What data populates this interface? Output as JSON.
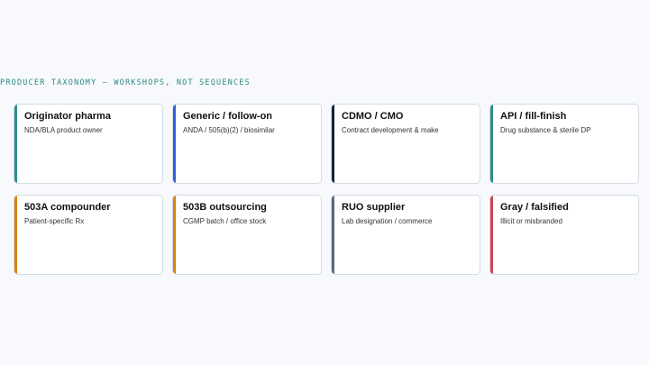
{
  "header": {
    "title": "PRODUCER TAXONOMY — WORKSHOPS, NOT SEQUENCES"
  },
  "cards": [
    {
      "key": "originator-pharma",
      "title": "Originator pharma",
      "subtitle": "NDA/BLA product owner",
      "accent_color": "#2e8b8b"
    },
    {
      "key": "generic-follow-on",
      "title": "Generic / follow-on",
      "subtitle": "ANDA / 505(b)(2) / biosimilar",
      "accent_color": "#3461d9"
    },
    {
      "key": "cdmo-cmo",
      "title": "CDMO / CMO",
      "subtitle": "Contract development & make",
      "accent_color": "#132339"
    },
    {
      "key": "api-fill-finish",
      "title": "API / fill-finish",
      "subtitle": "Drug substance & sterile DP",
      "accent_color": "#2e8b8b"
    },
    {
      "key": "503a-compounder",
      "title": "503A compounder",
      "subtitle": "Patient-specific Rx",
      "accent_color": "#d98016"
    },
    {
      "key": "503b-outsourcing",
      "title": "503B outsourcing",
      "subtitle": "CGMP batch / office stock",
      "accent_color": "#d98016"
    },
    {
      "key": "ruo-supplier",
      "title": "RUO supplier",
      "subtitle": "Lab designation / commerce",
      "accent_color": "#5a6781"
    },
    {
      "key": "gray-falsified",
      "title": "Gray / falsified",
      "subtitle": "Illicit or misbranded",
      "accent_color": "#c9474f"
    }
  ]
}
